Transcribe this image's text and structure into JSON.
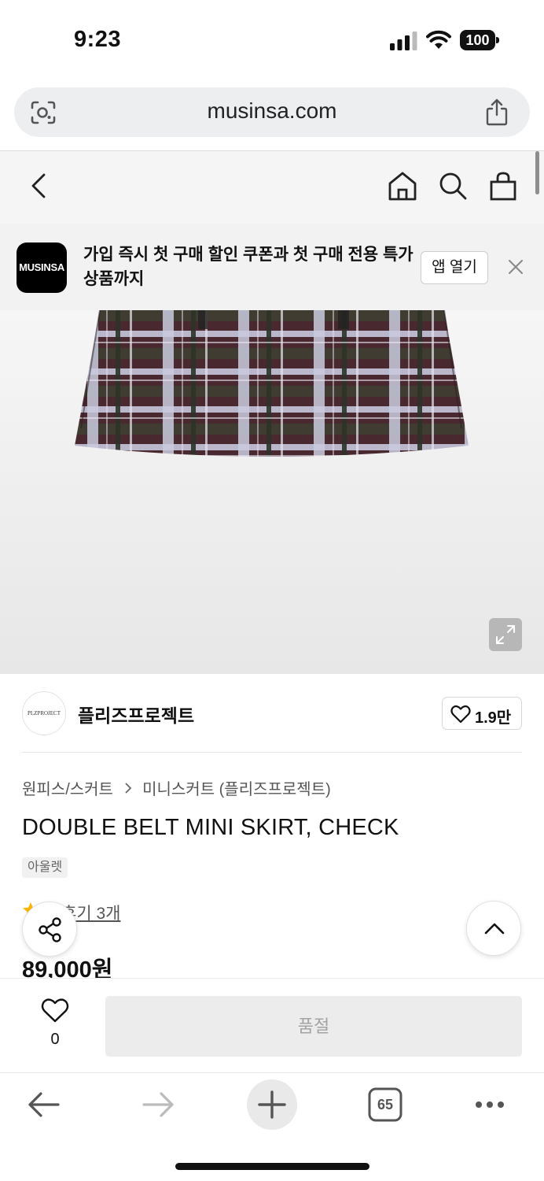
{
  "status_bar": {
    "time": "9:23",
    "battery": "100"
  },
  "browser": {
    "url": "musinsa.com",
    "tab_count": "65"
  },
  "header": {
    "icons": [
      "back-icon",
      "home-icon",
      "search-icon",
      "shopping-bag-icon"
    ]
  },
  "app_banner": {
    "logo_text": "MUSINSA",
    "message": "가입 즉시 첫 구매 할인 쿠폰과 첫 구매 전용 특가 상품까지",
    "open_app_label": "앱 열기"
  },
  "brand": {
    "logo_text": "PLZPROJECT",
    "name": "플리즈프로젝트",
    "like_count": "1.9만"
  },
  "breadcrumb": {
    "category": "원피스/스커트",
    "subcategory": "미니스커트 (플리즈프로젝트)"
  },
  "product": {
    "title": "DOUBLE BELT MINI SKIRT, CHECK",
    "badge": "아울렛",
    "review_label": "후기 3개",
    "price": "89,000원"
  },
  "purchase_bar": {
    "wish_count": "0",
    "buy_label": "품절"
  },
  "colors": {
    "star": "#ffb400",
    "soldout_bg": "#ececec",
    "header_bg": "#f5f5f5"
  }
}
